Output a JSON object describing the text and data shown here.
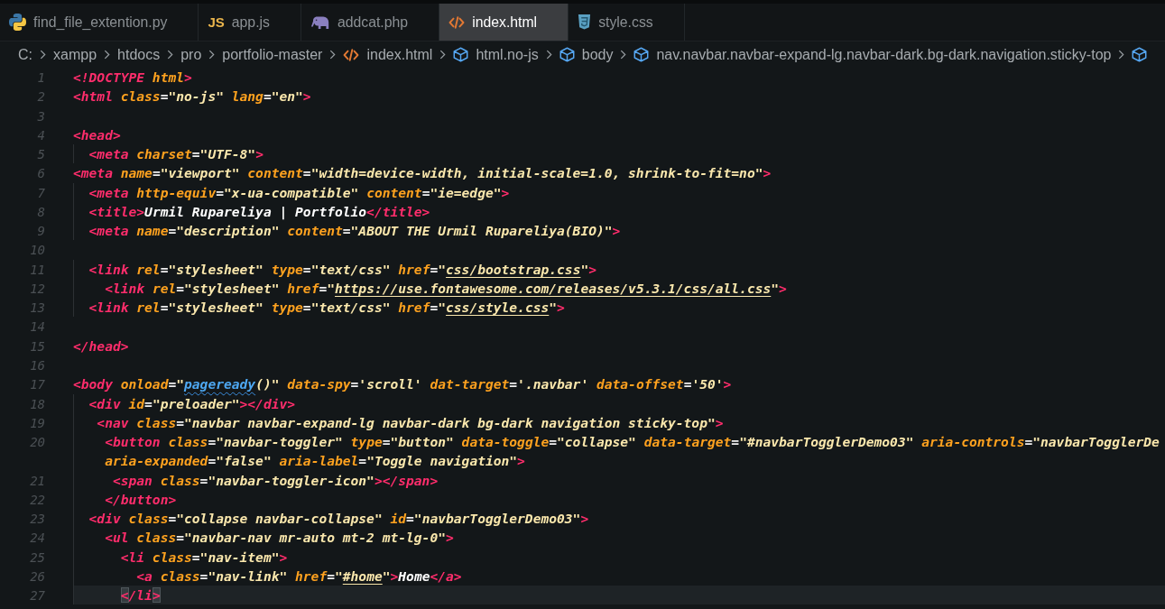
{
  "tabs": [
    {
      "label": "find_file_extention.py",
      "kind": "python",
      "selected": false
    },
    {
      "label": "app.js",
      "kind": "javascript",
      "icon_text": "JS",
      "selected": false
    },
    {
      "label": "addcat.php",
      "kind": "php",
      "selected": false
    },
    {
      "label": "index.html",
      "kind": "html",
      "selected": true
    },
    {
      "label": "style.css",
      "kind": "css",
      "selected": false
    }
  ],
  "breadcrumbs": [
    {
      "label": "C:",
      "kind": "folder"
    },
    {
      "label": "xampp",
      "kind": "folder"
    },
    {
      "label": "htdocs",
      "kind": "folder"
    },
    {
      "label": "pro",
      "kind": "folder"
    },
    {
      "label": "portfolio-master",
      "kind": "folder"
    },
    {
      "label": "index.html",
      "kind": "file"
    },
    {
      "label": "html.no-js",
      "kind": "element"
    },
    {
      "label": "body",
      "kind": "element"
    },
    {
      "label": "nav.navbar.navbar-expand-lg.navbar-dark.bg-dark.navigation.sticky-top",
      "kind": "element"
    },
    {
      "kind": "element"
    }
  ],
  "lines": [
    {
      "number": "1",
      "current": false,
      "tokens": [
        {
          "kind": "tag",
          "text": "<!DOCTYPE"
        },
        {
          "kind": "attr",
          "text": " html"
        },
        {
          "kind": "tag",
          "text": ">"
        }
      ]
    },
    {
      "number": "2",
      "current": false,
      "tokens": [
        {
          "kind": "tag",
          "text": "<html"
        },
        {
          "kind": "attr",
          "text": " class"
        },
        {
          "kind": "eq",
          "text": "="
        },
        {
          "kind": "str",
          "text": "\"no-js\""
        },
        {
          "kind": "attr",
          "text": " lang"
        },
        {
          "kind": "eq",
          "text": "="
        },
        {
          "kind": "str",
          "text": "\"en\""
        },
        {
          "kind": "tag",
          "text": ">"
        }
      ]
    },
    {
      "number": "3",
      "current": false
    },
    {
      "number": "4",
      "current": false,
      "tokens": [
        {
          "kind": "tag",
          "text": "<head>"
        }
      ]
    },
    {
      "number": "5",
      "current": false,
      "tokens": [
        {
          "kind": "tag",
          "text": "  <meta"
        },
        {
          "kind": "attr",
          "text": " charset"
        },
        {
          "kind": "eq",
          "text": "="
        },
        {
          "kind": "str",
          "text": "\"UTF-8\""
        },
        {
          "kind": "tag",
          "text": ">"
        }
      ]
    },
    {
      "number": "6",
      "current": false,
      "tokens": [
        {
          "kind": "tag",
          "text": "<meta"
        },
        {
          "kind": "attr",
          "text": " name"
        },
        {
          "kind": "eq",
          "text": "="
        },
        {
          "kind": "str",
          "text": "\"viewport\""
        },
        {
          "kind": "attr",
          "text": " content"
        },
        {
          "kind": "eq",
          "text": "="
        },
        {
          "kind": "str",
          "text": "\"width=device-width, initial-scale=1.0, shrink-to-fit=no\""
        },
        {
          "kind": "tag",
          "text": ">"
        }
      ]
    },
    {
      "number": "7",
      "current": false,
      "tokens": [
        {
          "kind": "tag",
          "text": "  <meta"
        },
        {
          "kind": "attr",
          "text": " http-equiv"
        },
        {
          "kind": "eq",
          "text": "="
        },
        {
          "kind": "str",
          "text": "\"x-ua-compatible\""
        },
        {
          "kind": "attr",
          "text": " content"
        },
        {
          "kind": "eq",
          "text": "="
        },
        {
          "kind": "str",
          "text": "\"ie=edge\""
        },
        {
          "kind": "tag",
          "text": ">"
        }
      ]
    },
    {
      "number": "8",
      "current": false,
      "tokens": [
        {
          "kind": "tag",
          "text": "  <title>"
        },
        {
          "kind": "text",
          "text": "Urmil Rupareliya | Portfolio"
        },
        {
          "kind": "tag",
          "text": "</title>"
        }
      ]
    },
    {
      "number": "9",
      "current": false,
      "tokens": [
        {
          "kind": "tag",
          "text": "  <meta"
        },
        {
          "kind": "attr",
          "text": " name"
        },
        {
          "kind": "eq",
          "text": "="
        },
        {
          "kind": "str",
          "text": "\"description\""
        },
        {
          "kind": "attr",
          "text": " content"
        },
        {
          "kind": "eq",
          "text": "="
        },
        {
          "kind": "str",
          "text": "\"ABOUT THE Urmil Rupareliya(BIO)\""
        },
        {
          "kind": "tag",
          "text": ">"
        }
      ]
    },
    {
      "number": "10",
      "current": false
    },
    {
      "number": "11",
      "current": false,
      "tokens": [
        {
          "kind": "tag",
          "text": "  <link"
        },
        {
          "kind": "attr",
          "text": " rel"
        },
        {
          "kind": "eq",
          "text": "="
        },
        {
          "kind": "str",
          "text": "\"stylesheet\""
        },
        {
          "kind": "attr",
          "text": " type"
        },
        {
          "kind": "eq",
          "text": "="
        },
        {
          "kind": "str",
          "text": "\"text/css\""
        },
        {
          "kind": "attr",
          "text": " href"
        },
        {
          "kind": "eq",
          "text": "="
        },
        {
          "kind": "str",
          "text": "\""
        },
        {
          "kind": "link",
          "text": "css/bootstrap.css"
        },
        {
          "kind": "str",
          "text": "\""
        },
        {
          "kind": "tag",
          "text": ">"
        }
      ]
    },
    {
      "number": "12",
      "current": false,
      "tokens": [
        {
          "kind": "tag",
          "text": "    <link"
        },
        {
          "kind": "attr",
          "text": " rel"
        },
        {
          "kind": "eq",
          "text": "="
        },
        {
          "kind": "str",
          "text": "\"stylesheet\""
        },
        {
          "kind": "attr",
          "text": " href"
        },
        {
          "kind": "eq",
          "text": "="
        },
        {
          "kind": "str",
          "text": "\""
        },
        {
          "kind": "link",
          "text": "https://use.fontawesome.com/releases/v5.3.1/css/all.css"
        },
        {
          "kind": "str",
          "text": "\""
        },
        {
          "kind": "tag",
          "text": ">"
        }
      ]
    },
    {
      "number": "13",
      "current": false,
      "tokens": [
        {
          "kind": "tag",
          "text": "  <link"
        },
        {
          "kind": "attr",
          "text": " rel"
        },
        {
          "kind": "eq",
          "text": "="
        },
        {
          "kind": "str",
          "text": "\"stylesheet\""
        },
        {
          "kind": "attr",
          "text": " type"
        },
        {
          "kind": "eq",
          "text": "="
        },
        {
          "kind": "str",
          "text": "\"text/css\""
        },
        {
          "kind": "attr",
          "text": " href"
        },
        {
          "kind": "eq",
          "text": "="
        },
        {
          "kind": "str",
          "text": "\""
        },
        {
          "kind": "link",
          "text": "css/style.css"
        },
        {
          "kind": "str",
          "text": "\""
        },
        {
          "kind": "tag",
          "text": ">"
        }
      ]
    },
    {
      "number": "14",
      "current": false
    },
    {
      "number": "15",
      "current": false,
      "tokens": [
        {
          "kind": "tag",
          "text": "</head>"
        }
      ]
    },
    {
      "number": "16",
      "current": false
    },
    {
      "number": "17",
      "current": false,
      "tokens": [
        {
          "kind": "tag",
          "text": "<body"
        },
        {
          "kind": "attr",
          "text": " onload"
        },
        {
          "kind": "eq",
          "text": "="
        },
        {
          "kind": "str",
          "text": "\""
        },
        {
          "kind": "call",
          "text": "pageready"
        },
        {
          "kind": "str",
          "text": "()\""
        },
        {
          "kind": "attr",
          "text": " data-spy"
        },
        {
          "kind": "eq",
          "text": "="
        },
        {
          "kind": "str",
          "text": "'scroll'"
        },
        {
          "kind": "attr",
          "text": " dat-target"
        },
        {
          "kind": "eq",
          "text": "="
        },
        {
          "kind": "str",
          "text": "'.navbar'"
        },
        {
          "kind": "attr",
          "text": " data-offset"
        },
        {
          "kind": "eq",
          "text": "="
        },
        {
          "kind": "str",
          "text": "'50'"
        },
        {
          "kind": "tag",
          "text": ">"
        }
      ]
    },
    {
      "number": "18",
      "current": false,
      "tokens": [
        {
          "kind": "tag",
          "text": "  <div"
        },
        {
          "kind": "attr",
          "text": " id"
        },
        {
          "kind": "eq",
          "text": "="
        },
        {
          "kind": "str",
          "text": "\"preloader\""
        },
        {
          "kind": "tag",
          "text": "></div>"
        }
      ]
    },
    {
      "number": "19",
      "current": false,
      "tokens": [
        {
          "kind": "tag",
          "text": "   <nav"
        },
        {
          "kind": "attr",
          "text": " class"
        },
        {
          "kind": "eq",
          "text": "="
        },
        {
          "kind": "str",
          "text": "\"navbar navbar-expand-lg navbar-dark bg-dark navigation sticky-top\""
        },
        {
          "kind": "tag",
          "text": ">"
        }
      ]
    },
    {
      "number": "20",
      "current": false,
      "tokens": [
        {
          "kind": "tag",
          "text": "    <button"
        },
        {
          "kind": "attr",
          "text": " class"
        },
        {
          "kind": "eq",
          "text": "="
        },
        {
          "kind": "str",
          "text": "\"navbar-toggler\""
        },
        {
          "kind": "attr",
          "text": " type"
        },
        {
          "kind": "eq",
          "text": "="
        },
        {
          "kind": "str",
          "text": "\"button\""
        },
        {
          "kind": "attr",
          "text": " data-toggle"
        },
        {
          "kind": "eq",
          "text": "="
        },
        {
          "kind": "str",
          "text": "\"collapse\""
        },
        {
          "kind": "attr",
          "text": " data-target"
        },
        {
          "kind": "eq",
          "text": "="
        },
        {
          "kind": "str",
          "text": "\"#navbarTogglerDemo03\""
        },
        {
          "kind": "attr",
          "text": " aria-controls"
        },
        {
          "kind": "eq",
          "text": "="
        },
        {
          "kind": "str",
          "text": "\"navbarTogglerDe"
        }
      ]
    },
    {
      "current": false,
      "tokens": [
        {
          "kind": "attr",
          "text": "    aria-expanded"
        },
        {
          "kind": "eq",
          "text": "="
        },
        {
          "kind": "str",
          "text": "\"false\""
        },
        {
          "kind": "attr",
          "text": " aria-label"
        },
        {
          "kind": "eq",
          "text": "="
        },
        {
          "kind": "str",
          "text": "\"Toggle navigation\""
        },
        {
          "kind": "tag",
          "text": ">"
        }
      ]
    },
    {
      "number": "21",
      "current": false,
      "tokens": [
        {
          "kind": "tag",
          "text": "     <span"
        },
        {
          "kind": "attr",
          "text": " class"
        },
        {
          "kind": "eq",
          "text": "="
        },
        {
          "kind": "str",
          "text": "\"navbar-toggler-icon\""
        },
        {
          "kind": "tag",
          "text": "></span>"
        }
      ]
    },
    {
      "number": "22",
      "current": false,
      "tokens": [
        {
          "kind": "tag",
          "text": "    </button>"
        }
      ]
    },
    {
      "number": "23",
      "current": false,
      "tokens": [
        {
          "kind": "tag",
          "text": "  <div"
        },
        {
          "kind": "attr",
          "text": " class"
        },
        {
          "kind": "eq",
          "text": "="
        },
        {
          "kind": "str",
          "text": "\"collapse navbar-collapse\""
        },
        {
          "kind": "attr",
          "text": " id"
        },
        {
          "kind": "eq",
          "text": "="
        },
        {
          "kind": "str",
          "text": "\"navbarTogglerDemo03\""
        },
        {
          "kind": "tag",
          "text": ">"
        }
      ]
    },
    {
      "number": "24",
      "current": false,
      "tokens": [
        {
          "kind": "tag",
          "text": "    <ul"
        },
        {
          "kind": "attr",
          "text": " class"
        },
        {
          "kind": "eq",
          "text": "="
        },
        {
          "kind": "str",
          "text": "\"navbar-nav mr-auto mt-2 mt-lg-0\""
        },
        {
          "kind": "tag",
          "text": ">"
        }
      ]
    },
    {
      "number": "25",
      "current": false,
      "tokens": [
        {
          "kind": "tag",
          "text": "      <li"
        },
        {
          "kind": "attr",
          "text": " class"
        },
        {
          "kind": "eq",
          "text": "="
        },
        {
          "kind": "str",
          "text": "\"nav-item\""
        },
        {
          "kind": "tag",
          "text": ">"
        }
      ]
    },
    {
      "number": "26",
      "current": false,
      "tokens": [
        {
          "kind": "tag",
          "text": "        <a"
        },
        {
          "kind": "attr",
          "text": " class"
        },
        {
          "kind": "eq",
          "text": "="
        },
        {
          "kind": "str",
          "text": "\"nav-link\""
        },
        {
          "kind": "attr",
          "text": " href"
        },
        {
          "kind": "eq",
          "text": "="
        },
        {
          "kind": "str",
          "text": "\""
        },
        {
          "kind": "link",
          "text": "#home"
        },
        {
          "kind": "str",
          "text": "\""
        },
        {
          "kind": "tag",
          "text": ">"
        },
        {
          "kind": "text",
          "text": "Home"
        },
        {
          "kind": "tag",
          "text": "</a>"
        }
      ]
    },
    {
      "number": "27",
      "current": true,
      "tokens": [
        {
          "kind": "match",
          "text": "      <"
        },
        {
          "kind": "tag",
          "text": "/li"
        },
        {
          "kind": "match",
          "text": ">"
        }
      ]
    }
  ]
}
